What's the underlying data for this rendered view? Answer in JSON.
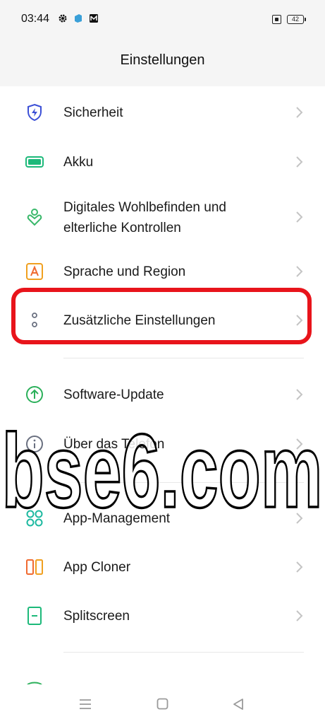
{
  "status_bar": {
    "time": "03:44",
    "battery": "42",
    "icons": [
      "gear-icon",
      "app-icon",
      "mail-icon",
      "sim-icon",
      "battery-icon"
    ]
  },
  "header": {
    "title": "Einstellungen"
  },
  "settings_items": [
    {
      "label": "Sicherheit",
      "icon": "shield-bolt-icon",
      "color": "#3b4fd6"
    },
    {
      "label": "Akku",
      "icon": "battery-icon",
      "color": "#1db97a"
    },
    {
      "label_line1": "Digitales Wohlbefinden und",
      "label_line2": "elterliche Kontrollen",
      "icon": "person-heart-icon",
      "color": "#39b86a"
    },
    {
      "label": "Sprache und Region",
      "icon": "language-a-icon",
      "color": "#f0a020"
    },
    {
      "label": "Zusätzliche Einstellungen",
      "icon": "more-dots-icon",
      "color": "#6a7080"
    },
    {
      "label": "Software-Update",
      "icon": "update-arrow-icon",
      "color": "#2bb05a"
    },
    {
      "label": "Über das Telefon",
      "icon": "info-icon",
      "color": "#6a7080"
    },
    {
      "label": "App-Management",
      "icon": "apps-grid-icon",
      "color": "#1db9a0"
    },
    {
      "label": "App Cloner",
      "icon": "app-cloner-icon",
      "color": "#f06a30"
    },
    {
      "label": "Splitscreen",
      "icon": "splitscreen-icon",
      "color": "#1db97a"
    }
  ],
  "highlight_color": "#e8141b",
  "watermark": {
    "text": "bse6.com"
  },
  "nav_bar": {
    "icons": [
      "menu-icon",
      "home-icon",
      "back-icon"
    ]
  }
}
